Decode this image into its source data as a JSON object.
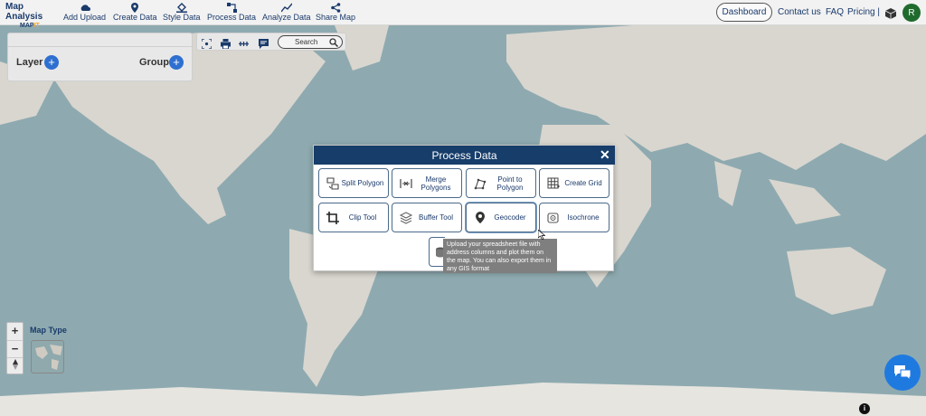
{
  "app": {
    "logo_line1": "Map Analysis",
    "logo_line2a": "MAP",
    "logo_line2b": "IT"
  },
  "nav": [
    {
      "label": "Add Upload",
      "icon": "cloud-upload-icon"
    },
    {
      "label": "Create Data",
      "icon": "map-pin-icon"
    },
    {
      "label": "Style Data",
      "icon": "paint-bucket-icon"
    },
    {
      "label": "Process Data",
      "icon": "process-icon"
    },
    {
      "label": "Analyze Data",
      "icon": "analyze-icon"
    },
    {
      "label": "Share Map",
      "icon": "share-icon"
    }
  ],
  "header_right": {
    "dashboard": "Dashboard",
    "contact": "Contact us",
    "faq": "FAQ",
    "pricing": "Pricing |",
    "avatar_initial": "R"
  },
  "layer_panel": {
    "layer_label": "Layer",
    "group_label": "Group"
  },
  "toolbar": {
    "search_label": "Search"
  },
  "map_controls": {
    "zoom_in": "+",
    "zoom_out": "−",
    "map_type_label": "Map Type"
  },
  "modal": {
    "title": "Process Data",
    "close": "✕",
    "tools": [
      {
        "label": "Split Polygon",
        "icon": "split-polygon-icon"
      },
      {
        "label": "Merge Polygons",
        "icon": "merge-polygons-icon"
      },
      {
        "label": "Point to Polygon",
        "icon": "point-to-polygon-icon"
      },
      {
        "label": "Create Grid",
        "icon": "grid-icon"
      },
      {
        "label": "Clip Tool",
        "icon": "crop-icon"
      },
      {
        "label": "Buffer Tool",
        "icon": "layers-icon"
      },
      {
        "label": "Geocoder",
        "icon": "location-pin-icon"
      },
      {
        "label": "Isochrone",
        "icon": "isochrone-icon"
      }
    ],
    "tooltip": "Upload your spreadsheet file with address columns and plot them on the map. You can also export them in any GIS format"
  },
  "colors": {
    "header_navy": "#173d6a",
    "accent_blue": "#2e6fd0",
    "chat_blue": "#1f7ae0",
    "avatar_green": "#1f6b2e"
  }
}
